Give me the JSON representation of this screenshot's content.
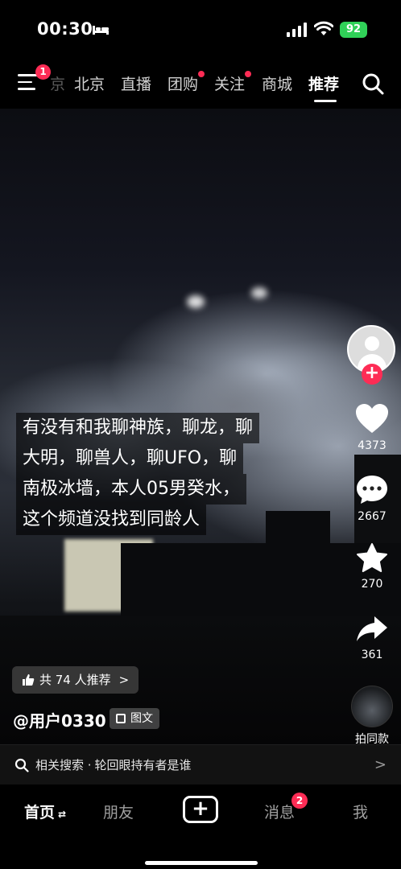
{
  "status_bar": {
    "time": "00:30",
    "battery": "92"
  },
  "top_nav": {
    "menu_badge": "1",
    "tabs": [
      {
        "label": "京"
      },
      {
        "label": "北京"
      },
      {
        "label": "直播"
      },
      {
        "label": "团购"
      },
      {
        "label": "关注"
      },
      {
        "label": "商城"
      },
      {
        "label": "推荐"
      }
    ]
  },
  "caption": {
    "lines": [
      "有没有和我聊神族，聊龙，聊",
      "大明，聊兽人，聊UFO，聊",
      "南极冰墙，本人05男癸水，",
      "这个频道没找到同龄人"
    ]
  },
  "rail": {
    "follow": "+",
    "like_count": "4373",
    "comment_count": "2667",
    "fav_count": "270",
    "share_count": "361",
    "remix_label": "拍同款"
  },
  "recommend": {
    "text": "共 74 人推荐",
    "arrow": ">"
  },
  "author": {
    "handle": "@用户0330",
    "tag": "图文"
  },
  "related_search": {
    "prefix": "相关搜索 · ",
    "query": "轮回眼持有者是谁",
    "arrow": ">"
  },
  "bottom_nav": {
    "home": "首页",
    "home_arrows": "⇄",
    "friends": "朋友",
    "create": "+",
    "messages": "消息",
    "messages_badge": "2",
    "me": "我"
  },
  "colors": {
    "accent": "#fe2c55",
    "battery": "#30d158"
  }
}
